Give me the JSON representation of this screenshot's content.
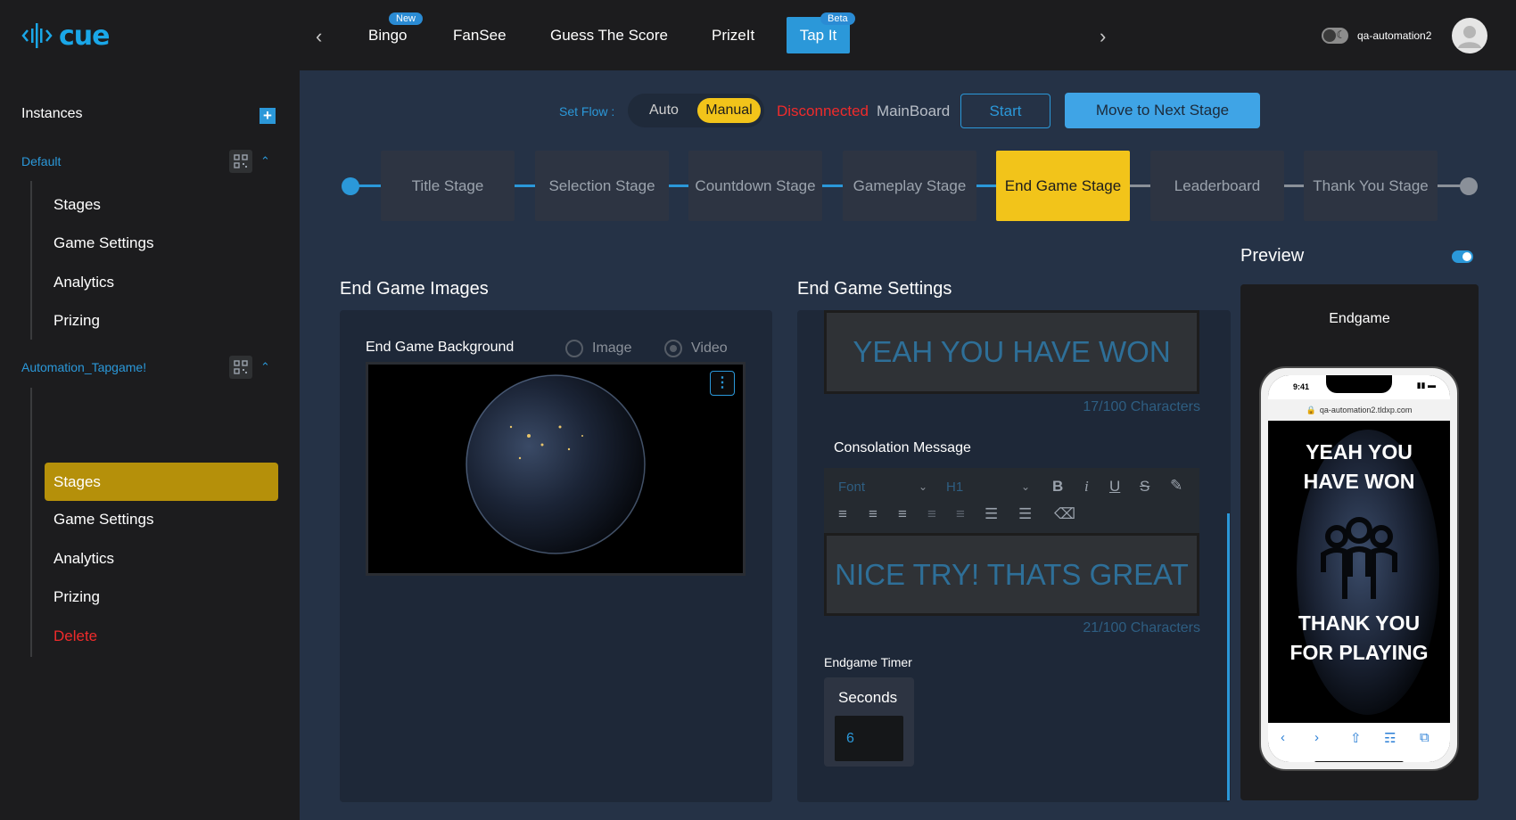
{
  "brand": {
    "name": "cue"
  },
  "nav": {
    "tabs": [
      {
        "label": "Bingo",
        "badge": "New"
      },
      {
        "label": "FanSee"
      },
      {
        "label": "Guess The Score"
      },
      {
        "label": "PrizeIt"
      },
      {
        "label": "Tap It",
        "badge": "Beta",
        "active": true
      }
    ]
  },
  "user": {
    "name": "qa-automation2"
  },
  "sidebar": {
    "title": "Instances",
    "groups": [
      {
        "name": "Default",
        "items": [
          "Stages",
          "Game Settings",
          "Analytics",
          "Prizing"
        ]
      },
      {
        "name": "Automation_Tapgame!",
        "items": [
          "Stages",
          "Game Settings",
          "Analytics",
          "Prizing"
        ],
        "active_item": "Stages",
        "delete_label": "Delete"
      }
    ]
  },
  "flow": {
    "set_flow_label": "Set Flow :",
    "auto_label": "Auto",
    "manual_label": "Manual",
    "selected": "Manual",
    "status": "Disconnected",
    "board": "MainBoard",
    "start_label": "Start",
    "next_label": "Move to Next Stage"
  },
  "stages": [
    "Title Stage",
    "Selection Stage",
    "Countdown Stage",
    "Gameplay Stage",
    "End Game Stage",
    "Leaderboard",
    "Thank You Stage"
  ],
  "active_stage": "End Game Stage",
  "images": {
    "title": "End Game Images",
    "background_label": "End Game Background",
    "options": [
      "Image",
      "Video"
    ],
    "selected_option": "Video"
  },
  "settings": {
    "title": "End Game Settings",
    "win_message": "YEAH YOU HAVE WON",
    "win_count": "17/100 Characters",
    "consolation_label": "Consolation Message",
    "font_placeholder": "Font",
    "heading": "H1",
    "consolation_message": "NICE TRY! THATS GREAT",
    "consolation_count": "21/100 Characters",
    "timer_label": "Endgame Timer",
    "seconds_label": "Seconds",
    "seconds_value": "6"
  },
  "preview": {
    "title": "Preview",
    "caption": "Endgame",
    "time": "9:41",
    "url": "qa-automation2.tldxp.com",
    "line1": "YEAH YOU",
    "line2": "HAVE WON",
    "line3": "THANK YOU",
    "line4": "FOR PLAYING"
  },
  "colors": {
    "accent": "#2b98d9",
    "highlight": "#f2c41a",
    "danger": "#ef2b2b",
    "sidebar_active": "#b5900a"
  }
}
